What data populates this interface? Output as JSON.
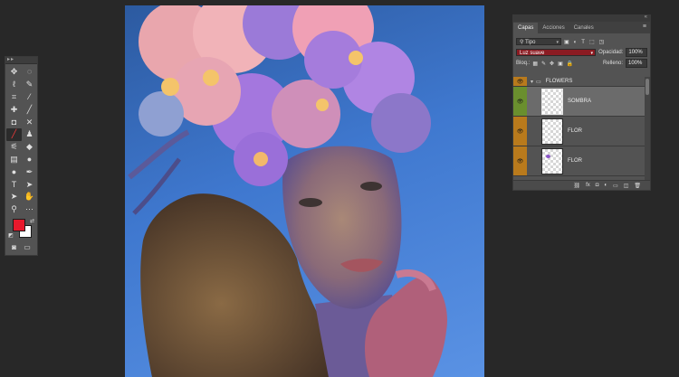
{
  "toolbar": {
    "header": "▸▸",
    "tools": [
      {
        "name": "move-tool-icon",
        "glyph": "✥"
      },
      {
        "name": "ellipse-marquee-tool-icon",
        "glyph": "◌"
      },
      {
        "name": "lasso-tool-icon",
        "glyph": "ℓ"
      },
      {
        "name": "quick-selection-tool-icon",
        "glyph": "✎"
      },
      {
        "name": "crop-tool-icon",
        "glyph": "⌗"
      },
      {
        "name": "eyedropper-tool-icon",
        "glyph": "⁄"
      },
      {
        "name": "spot-healing-brush-tool-icon",
        "glyph": "✚"
      },
      {
        "name": "ruler-tool-icon",
        "glyph": "╱"
      },
      {
        "name": "patch-tool-icon",
        "glyph": "◘"
      },
      {
        "name": "content-aware-move-tool-icon",
        "glyph": "✕"
      },
      {
        "name": "brush-tool-icon",
        "glyph": "╱"
      },
      {
        "name": "clone-stamp-tool-icon",
        "glyph": "♟"
      },
      {
        "name": "history-brush-tool-icon",
        "glyph": "⚟"
      },
      {
        "name": "eraser-tool-icon",
        "glyph": "◆"
      },
      {
        "name": "gradient-tool-icon",
        "glyph": "▤"
      },
      {
        "name": "blur-tool-icon",
        "glyph": "●"
      },
      {
        "name": "dodge-tool-icon",
        "glyph": "●"
      },
      {
        "name": "pen-tool-icon",
        "glyph": "✒"
      },
      {
        "name": "type-tool-icon",
        "glyph": "T"
      },
      {
        "name": "path-selection-tool-icon",
        "glyph": "➤"
      },
      {
        "name": "direct-selection-tool-icon",
        "glyph": "➤"
      },
      {
        "name": "hand-tool-icon",
        "glyph": "✋"
      },
      {
        "name": "zoom-tool-icon",
        "glyph": "⚲"
      },
      {
        "name": "extra-tools-icon",
        "glyph": "⋯"
      }
    ],
    "active_tool_index": 10,
    "foreground_color": "#e8192c",
    "background_color": "#ffffff",
    "swap_glyph": "⇄",
    "default_glyph": "◩",
    "quick_mask_glyph": "◙",
    "screen_mode_glyph": "▭"
  },
  "panel": {
    "header_collapse": "«",
    "tabs": [
      {
        "label": "Capas",
        "active": true
      },
      {
        "label": "Acciones",
        "active": false
      },
      {
        "label": "Canales",
        "active": false
      }
    ],
    "menu_glyph": "≡",
    "filter": {
      "label": "Tipo",
      "icons": [
        "▣",
        "◐",
        "T",
        "⬚",
        "◳"
      ]
    },
    "blend_mode": "Luz suave",
    "opacity_label": "Opacidad:",
    "opacity_value": "100%",
    "lock_label": "Bloq.:",
    "lock_icons": [
      "▦",
      "✎",
      "✥",
      "▣",
      "🔒"
    ],
    "fill_label": "Relleno:",
    "fill_value": "100%",
    "layers": [
      {
        "type": "group",
        "name": "FLOWERS",
        "visible": true
      },
      {
        "type": "layer",
        "name": "SOMBRA",
        "selected": true,
        "visible": true
      },
      {
        "type": "layer",
        "name": "FLOR",
        "selected": false,
        "visible": true
      },
      {
        "type": "layer",
        "name": "FLOR",
        "selected": false,
        "visible": true
      }
    ],
    "bottom_icons": [
      "⛓",
      "fx",
      "◘",
      "◐",
      "▭",
      "◫",
      "🗑"
    ]
  },
  "colors": {
    "selected_eye": "#6a8f2e",
    "eye": "#b97a1c",
    "blend_bg": "#8b1b22"
  }
}
